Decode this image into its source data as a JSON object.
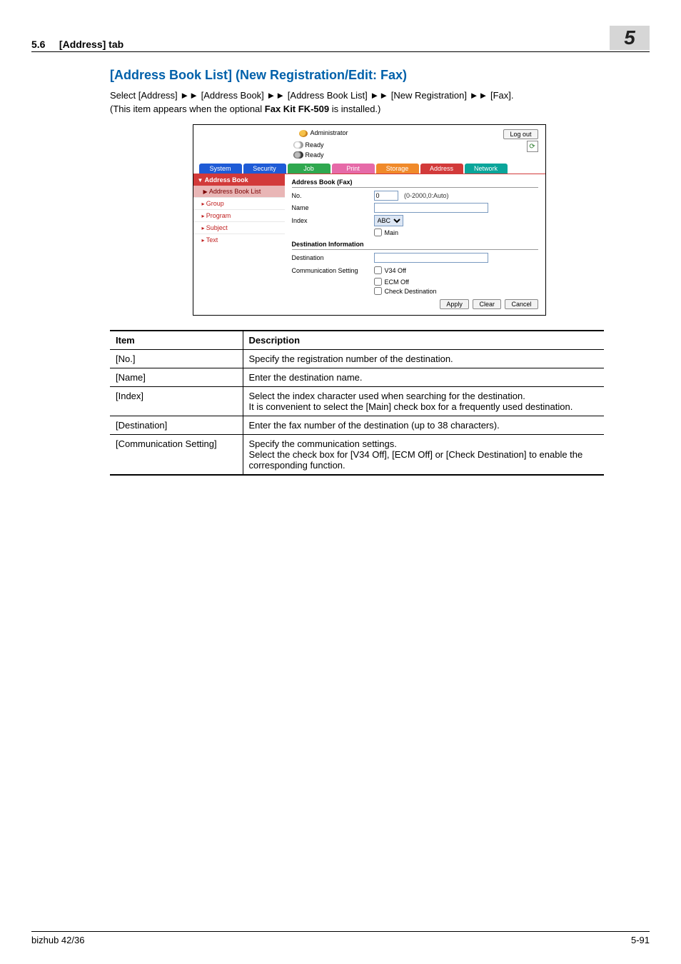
{
  "page_header": {
    "section_number": "5.6",
    "section_title": "[Address] tab",
    "chapter_badge": "5"
  },
  "section": {
    "heading": "[Address Book List] (New Registration/Edit: Fax)",
    "path_prefix": "Select [Address] ",
    "arrow": "►►",
    "path_parts": [
      "[Address Book]",
      "[Address Book List]",
      "[New Registration]",
      "[Fax]."
    ],
    "note_prefix": "(This item appears when the optional ",
    "note_bold": "Fax Kit FK-509",
    "note_suffix": " is installed.)"
  },
  "screenshot": {
    "admin_label": "Administrator",
    "logout": "Log out",
    "ready1": "Ready",
    "ready2": "Ready",
    "tabs": [
      "System",
      "Security",
      "Job",
      "Print",
      "Storage",
      "Address",
      "Network"
    ],
    "sidebar": {
      "head": "Address Book",
      "active": "Address Book List",
      "items": [
        "Group",
        "Program",
        "Subject",
        "Text"
      ]
    },
    "form": {
      "title": "Address Book (Fax)",
      "no_label": "No.",
      "no_value": "0",
      "no_hint": "(0-2000,0:Auto)",
      "name_label": "Name",
      "name_value": "",
      "index_label": "Index",
      "index_value": "ABC",
      "main_cb": "Main",
      "dest_head": "Destination Information",
      "dest_label": "Destination",
      "dest_value": "",
      "comm_label": "Communication Setting",
      "v34": "V34 Off",
      "ecm": "ECM Off",
      "chk": "Check Destination",
      "apply": "Apply",
      "clear": "Clear",
      "cancel": "Cancel"
    }
  },
  "table": {
    "h1": "Item",
    "h2": "Description",
    "rows": [
      {
        "item": "[No.]",
        "desc": "Specify the registration number of the destination."
      },
      {
        "item": "[Name]",
        "desc": "Enter the destination name."
      },
      {
        "item": "[Index]",
        "desc": "Select the index character used when searching for the destination.\nIt is convenient to select the [Main] check box for a frequently used destination."
      },
      {
        "item": "[Destination]",
        "desc": "Enter the fax number of the destination (up to 38 characters)."
      },
      {
        "item": "[Communication Setting]",
        "desc": "Specify the communication settings.\nSelect the check box for [V34 Off], [ECM Off] or [Check Destination] to enable the corresponding function."
      }
    ]
  },
  "footer": {
    "left": "bizhub 42/36",
    "right": "5-91"
  }
}
